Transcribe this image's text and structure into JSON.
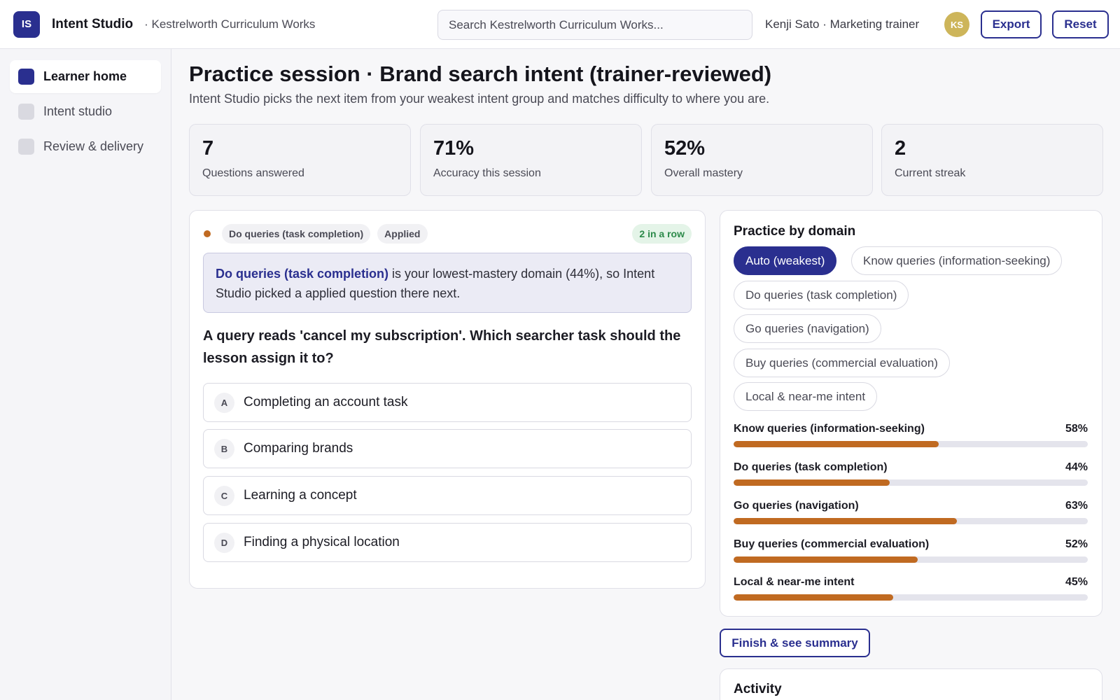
{
  "topbar": {
    "logo": "IS",
    "app_name": "Intent Studio",
    "org": "· Kestrelworth Curriculum Works",
    "search_placeholder": "Search Kestrelworth Curriculum Works...",
    "user": "Kenji Sato · Marketing trainer",
    "avatar": "KS",
    "export_label": "Export",
    "reset_label": "Reset"
  },
  "sidebar": {
    "items": [
      {
        "label": "Learner home",
        "active": true
      },
      {
        "label": "Intent studio",
        "active": false
      },
      {
        "label": "Review & delivery",
        "active": false
      }
    ]
  },
  "page": {
    "title": "Practice session · Brand search intent (trainer-reviewed)",
    "subtitle": "Intent Studio picks the next item from your weakest intent group and matches difficulty to where you are."
  },
  "stats": [
    {
      "value": "7",
      "label": "Questions answered"
    },
    {
      "value": "71%",
      "label": "Accuracy this session"
    },
    {
      "value": "52%",
      "label": "Overall mastery"
    },
    {
      "value": "2",
      "label": "Current streak"
    }
  ],
  "question_card": {
    "domain_chip": "Do queries (task completion)",
    "level_chip": "Applied",
    "streak": "2 in a row",
    "reason_domain": "Do queries (task completion)",
    "reason_text": " is your lowest-mastery domain (44%), so Intent Studio picked a applied question there next.",
    "question": "A query reads 'cancel my subscription'. Which searcher task should the lesson assign it to?",
    "options": [
      {
        "key": "A",
        "text": "Completing an account task"
      },
      {
        "key": "B",
        "text": "Comparing brands"
      },
      {
        "key": "C",
        "text": "Learning a concept"
      },
      {
        "key": "D",
        "text": "Finding a physical location"
      }
    ]
  },
  "practice": {
    "title": "Practice by domain",
    "pills": [
      {
        "label": "Auto (weakest)",
        "active": true
      },
      {
        "label": "Know queries (information-seeking)",
        "active": false
      },
      {
        "label": "Do queries (task completion)",
        "active": false
      },
      {
        "label": "Go queries (navigation)",
        "active": false
      },
      {
        "label": "Buy queries (commercial evaluation)",
        "active": false
      },
      {
        "label": "Local & near-me intent",
        "active": false
      }
    ],
    "mastery": [
      {
        "label": "Know queries (information-seeking)",
        "pct": "58%",
        "value": 58
      },
      {
        "label": "Do queries (task completion)",
        "pct": "44%",
        "value": 44
      },
      {
        "label": "Go queries (navigation)",
        "pct": "63%",
        "value": 63
      },
      {
        "label": "Buy queries (commercial evaluation)",
        "pct": "52%",
        "value": 52
      },
      {
        "label": "Local & near-me intent",
        "pct": "45%",
        "value": 45
      }
    ]
  },
  "finish_label": "Finish & see summary",
  "activity_title": "Activity",
  "colors": {
    "accent": "#2a2f8f",
    "mastery_bar": "#c06a21",
    "streak_text": "#2c8a4a"
  }
}
